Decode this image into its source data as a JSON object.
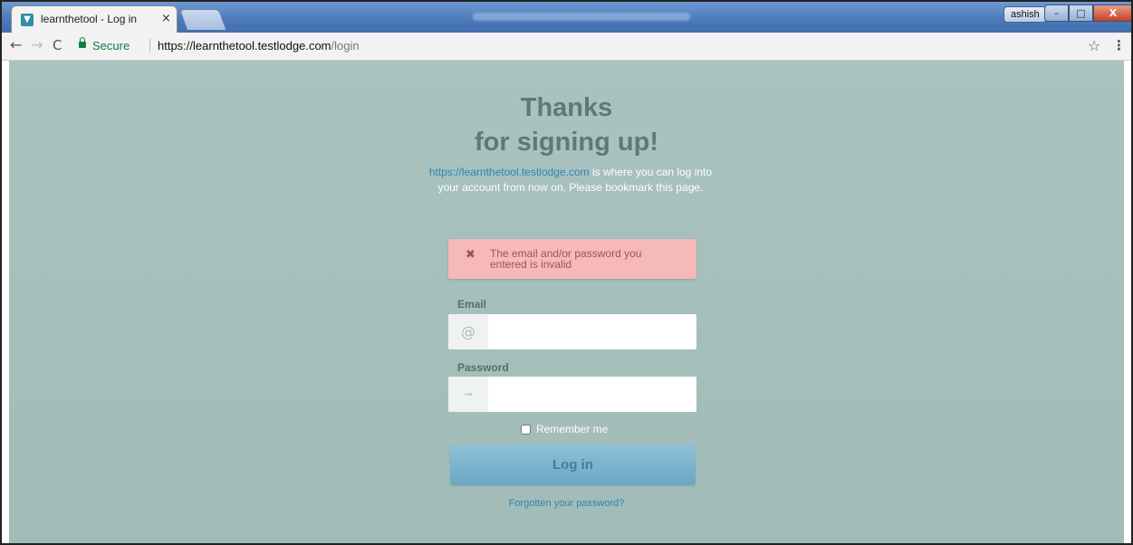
{
  "browser": {
    "tab": {
      "title": "learnthetool - Log in",
      "close": "×"
    },
    "user_badge": "ashish",
    "window_controls": {
      "minimize": "–",
      "maximize": "□",
      "close": "X"
    },
    "address_bar": {
      "secure_label": "Secure",
      "url_host": "https://learnthetool.testlodge.com",
      "url_path": "/login"
    },
    "icons": {
      "back": "←",
      "forward": "→",
      "reload": "C",
      "star": "☆",
      "menu": "⋮"
    }
  },
  "page": {
    "heading_line1": "Thanks",
    "heading_line2": "for signing up!",
    "intro_link": "https://learnthetool.testlodge.com",
    "intro_rest": " is where you can log into your account from now on. Please bookmark this page.",
    "alert": {
      "icon": "✖",
      "message": "The email and/or password you entered is invalid"
    },
    "form": {
      "email_label": "Email",
      "email_icon": "@",
      "email_value": "",
      "password_label": "Password",
      "password_icon": "⊸",
      "password_value": "",
      "remember_label": "Remember me",
      "remember_checked": false,
      "submit_label": "Log in",
      "forgot_label": "Forgotten your password?"
    }
  },
  "colors": {
    "page_background": "#a9c3bf",
    "heading": "#5f7a76",
    "link": "#2f86b3",
    "alert_background": "#f5b9b8",
    "alert_text": "#a05252",
    "button": "#7ab4cd"
  }
}
